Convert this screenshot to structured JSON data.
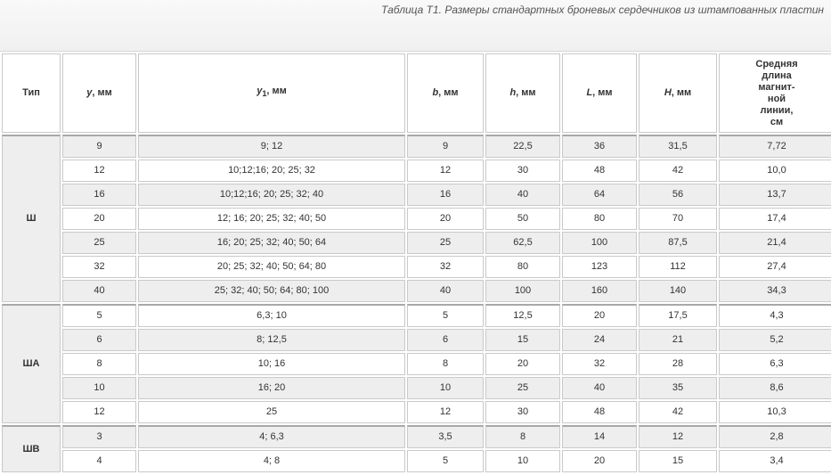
{
  "caption": "Таблица Т1. Размеры стандартных броневых сердечников из штампованных пластин",
  "headers": {
    "type": "Тип",
    "y": {
      "sym": "y",
      "unit": ", мм"
    },
    "y1": {
      "sym": "y",
      "sub": "1",
      "unit": ", мм"
    },
    "b": {
      "sym": "b",
      "unit": ", мм"
    },
    "h": {
      "sym": "h",
      "unit": ", мм"
    },
    "L": {
      "sym": "L",
      "unit": ", мм"
    },
    "H": {
      "sym": "H",
      "unit": ", мм"
    },
    "lm": [
      "Средняя",
      "длина",
      "магнит-",
      "ной",
      "линии,",
      "см"
    ]
  },
  "groups": [
    {
      "type": "Ш",
      "rows": [
        [
          "9",
          "9; 12",
          "9",
          "22,5",
          "36",
          "31,5",
          "7,72"
        ],
        [
          "12",
          "10;12;16; 20; 25; 32",
          "12",
          "30",
          "48",
          "42",
          "10,0"
        ],
        [
          "16",
          "10;12;16; 20; 25; 32; 40",
          "16",
          "40",
          "64",
          "56",
          "13,7"
        ],
        [
          "20",
          "12; 16; 20; 25; 32; 40; 50",
          "20",
          "50",
          "80",
          "70",
          "17,4"
        ],
        [
          "25",
          "16; 20; 25; 32; 40; 50; 64",
          "25",
          "62,5",
          "100",
          "87,5",
          "21,4"
        ],
        [
          "32",
          "20; 25; 32; 40; 50; 64; 80",
          "32",
          "80",
          "123",
          "112",
          "27,4"
        ],
        [
          "40",
          "25; 32; 40; 50; 64; 80; 100",
          "40",
          "100",
          "160",
          "140",
          "34,3"
        ]
      ]
    },
    {
      "type": "ША",
      "rows": [
        [
          "5",
          "6,3; 10",
          "5",
          "12,5",
          "20",
          "17,5",
          "4,3"
        ],
        [
          "6",
          "8; 12,5",
          "6",
          "15",
          "24",
          "21",
          "5,2"
        ],
        [
          "8",
          "10; 16",
          "8",
          "20",
          "32",
          "28",
          "6,3"
        ],
        [
          "10",
          "16; 20",
          "10",
          "25",
          "40",
          "35",
          "8,6"
        ],
        [
          "12",
          "25",
          "12",
          "30",
          "48",
          "42",
          "10,3"
        ]
      ]
    },
    {
      "type": "ШВ",
      "rows": [
        [
          "3",
          "4; 6,3",
          "3,5",
          "8",
          "14",
          "12",
          "2,8"
        ],
        [
          "4",
          "4; 8",
          "5",
          "10",
          "20",
          "15",
          "3,4"
        ]
      ]
    }
  ]
}
